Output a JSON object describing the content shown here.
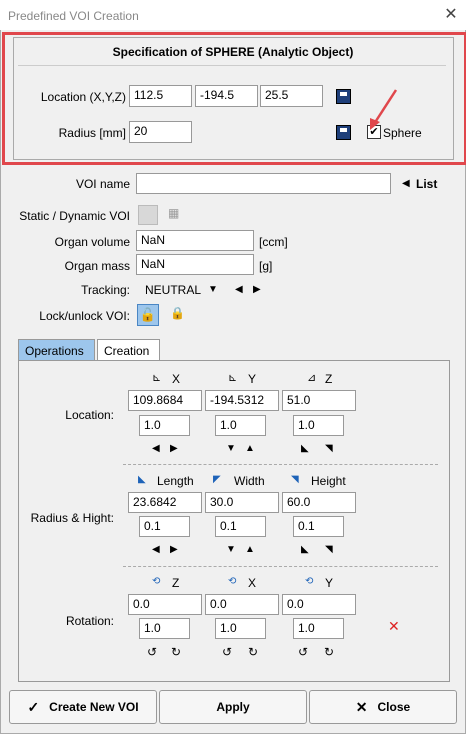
{
  "window": {
    "title": "Predefined VOI Creation"
  },
  "spec": {
    "title": "Specification of SPHERE (Analytic Object)",
    "location_label": "Location (X,Y,Z)",
    "x": "112.5",
    "y": "-194.5",
    "z": "25.5",
    "radius_label": "Radius [mm]",
    "radius": "20",
    "sphere_label": "Sphere",
    "sphere_checked": true
  },
  "form": {
    "voi_name_label": "VOI name",
    "voi_name": "",
    "list_label": "List",
    "static_dynamic_label": "Static / Dynamic VOI",
    "organ_volume_label": "Organ volume",
    "organ_volume": "NaN",
    "organ_volume_unit": "[ccm]",
    "organ_mass_label": "Organ mass",
    "organ_mass": "NaN",
    "organ_mass_unit": "[g]",
    "tracking_label": "Tracking:",
    "tracking_value": "NEUTRAL",
    "lock_label": "Lock/unlock VOI:"
  },
  "tabs": [
    {
      "label": "Operations"
    },
    {
      "label": "Creation"
    }
  ],
  "ops": {
    "location": {
      "label": "Location:",
      "headers": [
        "X",
        "Y",
        "Z"
      ],
      "values": [
        "109.8684",
        "-194.5312",
        "51.0"
      ],
      "steps": [
        "1.0",
        "1.0",
        "1.0"
      ]
    },
    "radius": {
      "label": "Radius & Hight:",
      "headers": [
        "Length",
        "Width",
        "Height"
      ],
      "values": [
        "23.6842",
        "30.0",
        "60.0"
      ],
      "steps": [
        "0.1",
        "0.1",
        "0.1"
      ]
    },
    "rotation": {
      "label": "Rotation:",
      "headers": [
        "Z",
        "X",
        "Y"
      ],
      "values": [
        "0.0",
        "0.0",
        "0.0"
      ],
      "steps": [
        "1.0",
        "1.0",
        "1.0"
      ]
    }
  },
  "buttons": {
    "create": "Create New VOI",
    "apply": "Apply",
    "close": "Close"
  },
  "colors": {
    "highlight": "#e0474c",
    "tab_active": "#9dc6ec",
    "icon_blue": "#1e63b8"
  }
}
